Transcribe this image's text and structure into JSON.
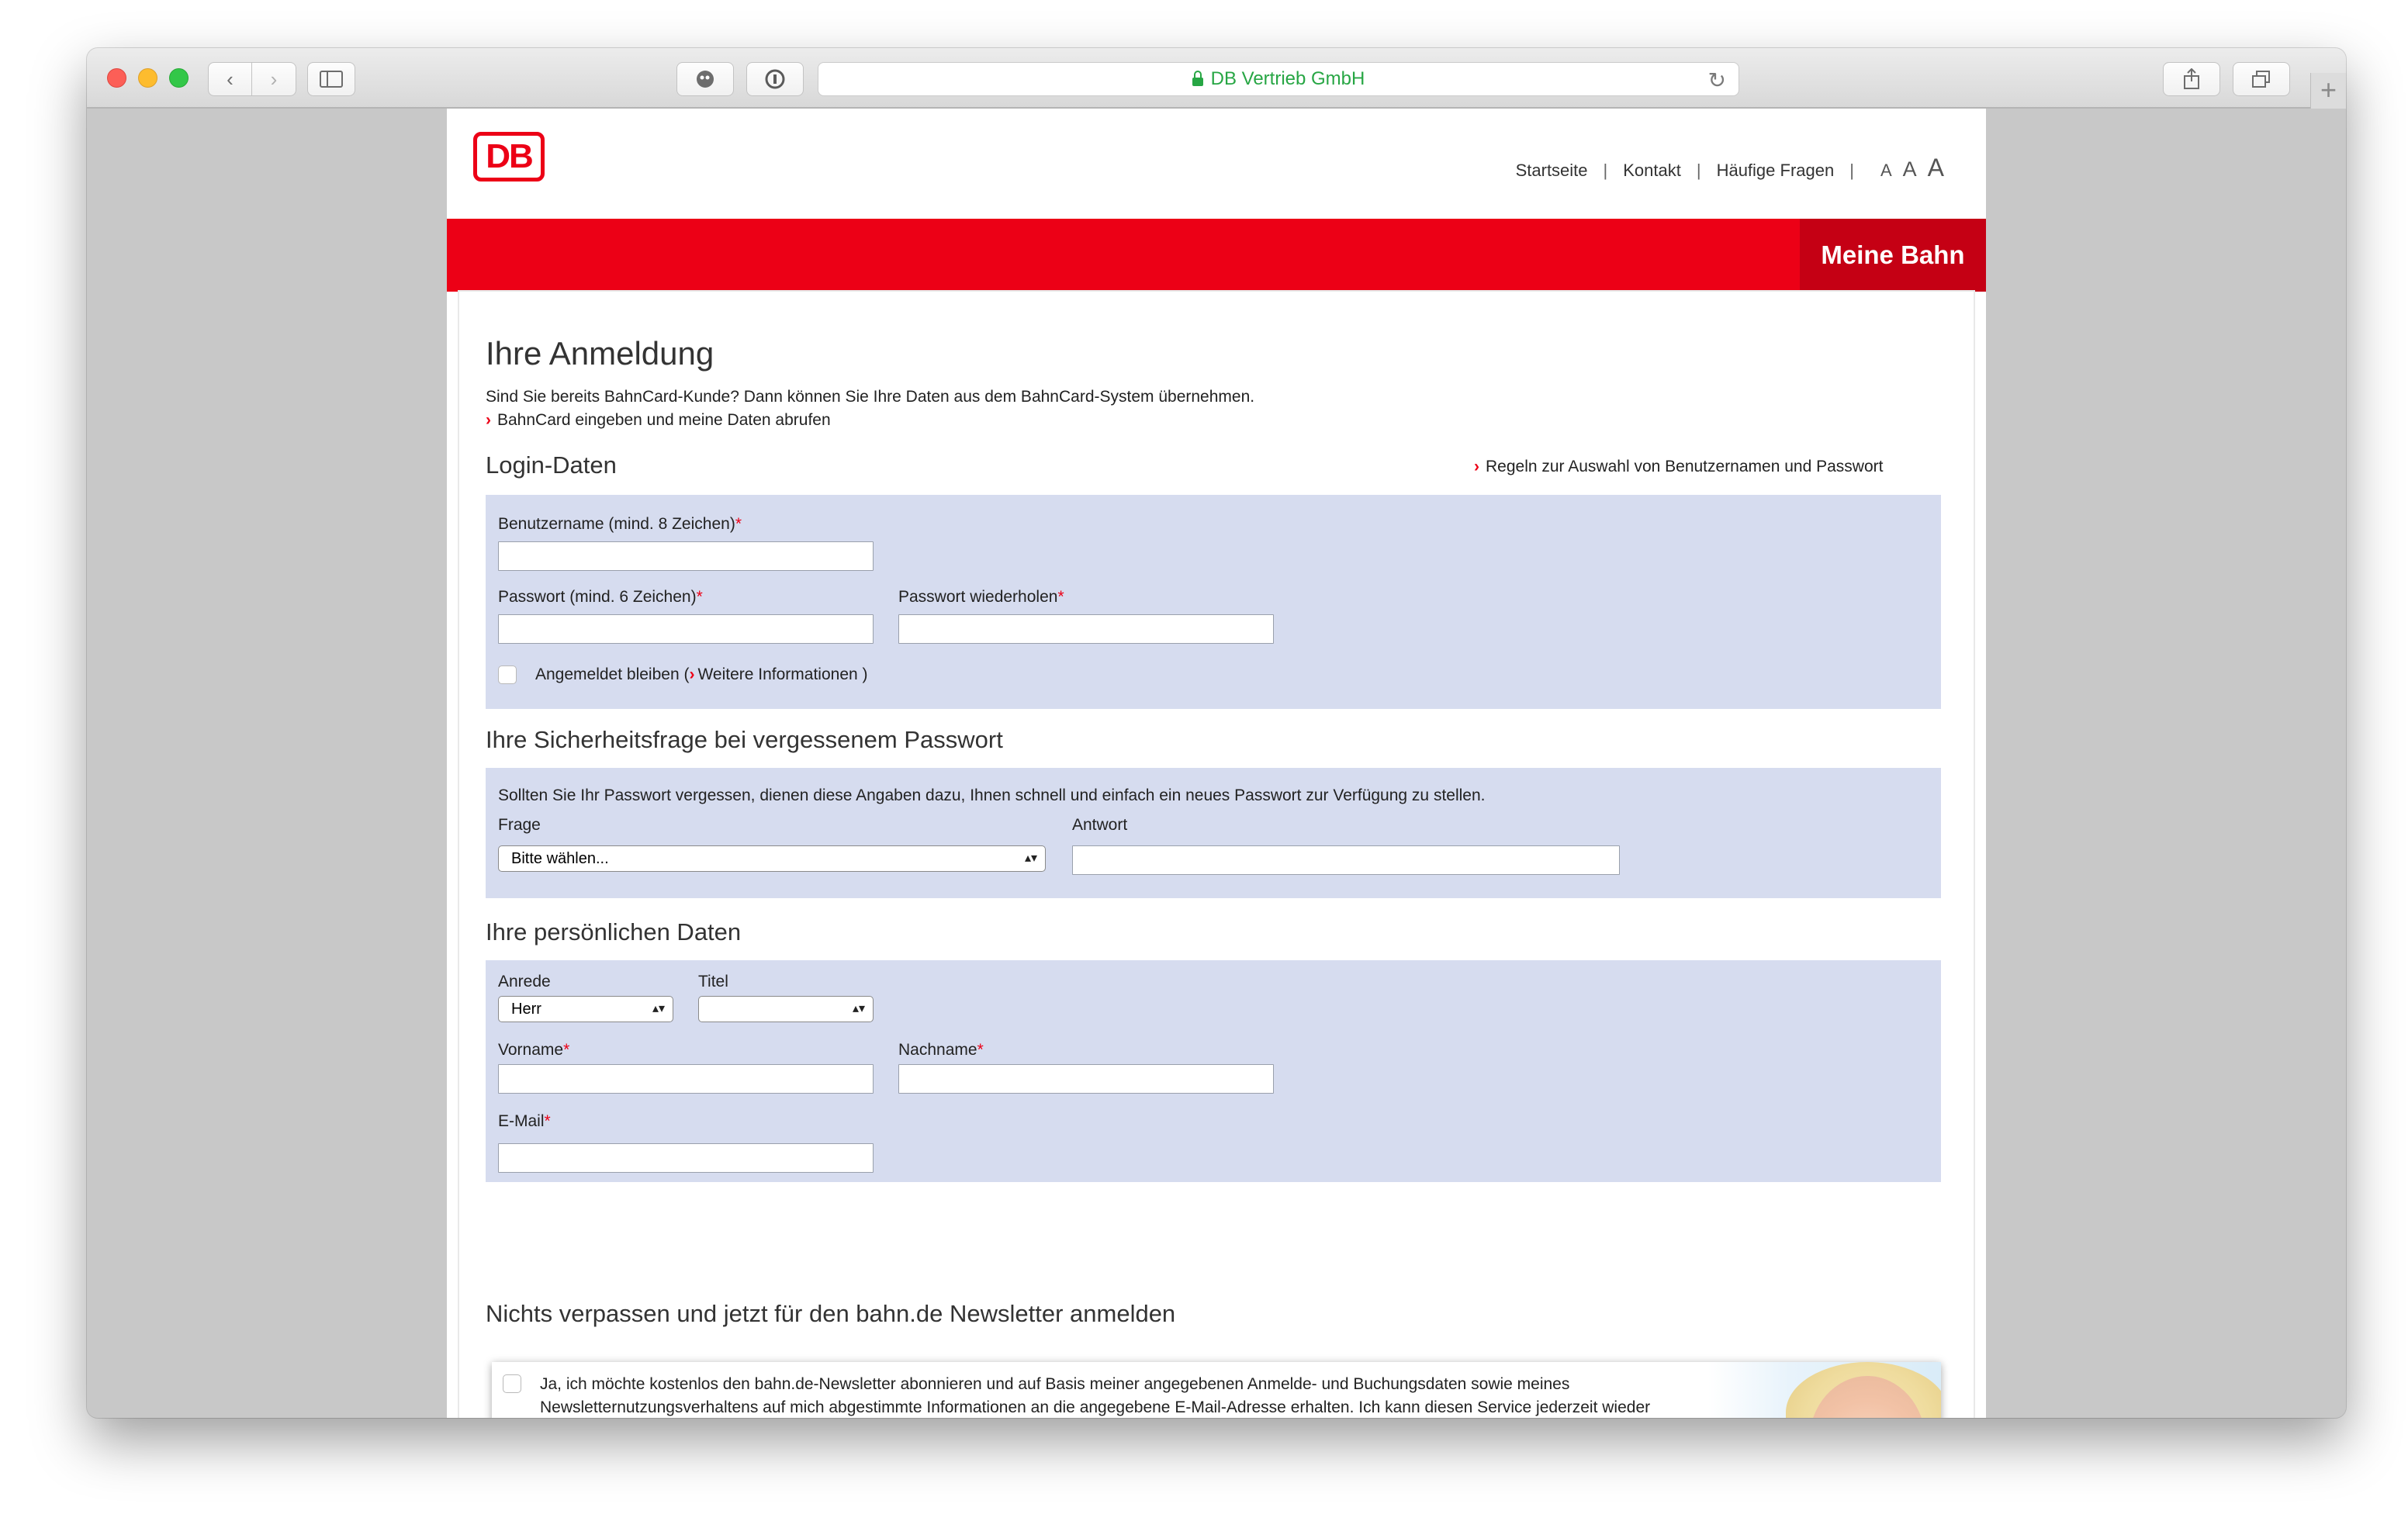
{
  "browser": {
    "address_text": "DB Vertrieb GmbH",
    "new_tab_label": "+"
  },
  "header": {
    "logo_text": "DB",
    "nav": [
      "Startseite",
      "Kontakt",
      "Häufige Fragen"
    ],
    "font_sizes": [
      "A",
      "A",
      "A"
    ],
    "section_title": "Meine Bahn"
  },
  "main": {
    "title": "Ihre Anmeldung",
    "intro": "Sind Sie bereits BahnCard-Kunde? Dann können Sie Ihre Daten aus dem BahnCard-System übernehmen.",
    "bahncard_link": "BahnCard eingeben und meine Daten abrufen"
  },
  "login": {
    "heading": "Login-Daten",
    "rules_link": "Regeln zur Auswahl von Benutzernamen und Passwort",
    "username_label": "Benutzername (mind. 8 Zeichen)",
    "password_label": "Passwort (mind. 6 Zeichen)",
    "password_repeat_label": "Passwort wiederholen",
    "required_mark": "*",
    "stay_logged_in": "Angemeldet bleiben (",
    "more_info_link": "Weitere Informationen",
    "close_paren": " )"
  },
  "security": {
    "heading": "Ihre Sicherheitsfrage bei vergessenem Passwort",
    "note": "Sollten Sie Ihr Passwort vergessen, dienen diese Angaben dazu, Ihnen schnell und einfach ein neues Passwort zur Verfügung zu stellen.",
    "question_label": "Frage",
    "question_value": "Bitte wählen...",
    "answer_label": "Antwort"
  },
  "personal": {
    "heading": "Ihre persönlichen Daten",
    "salutation_label": "Anrede",
    "salutation_value": "Herr",
    "title_label": "Titel",
    "title_value": "",
    "firstname_label": "Vorname",
    "lastname_label": "Nachname",
    "email_label": "E-Mail"
  },
  "newsletter": {
    "heading": "Nichts verpassen und jetzt für den bahn.de Newsletter anmelden",
    "text": "Ja, ich möchte kostenlos den bahn.de-Newsletter abonnieren und auf Basis meiner angegebenen Anmelde- und Buchungsdaten sowie meines Newsletternutzungsverhaltens auf mich abgestimmte Informationen an die angegebene E-Mail-Adresse erhalten. Ich kann diesen Service jederzeit wieder abbestellen."
  },
  "colors": {
    "db_red": "#ec0016",
    "meine_bahn_red": "#c50014",
    "panel_blue": "#d6dcef"
  }
}
